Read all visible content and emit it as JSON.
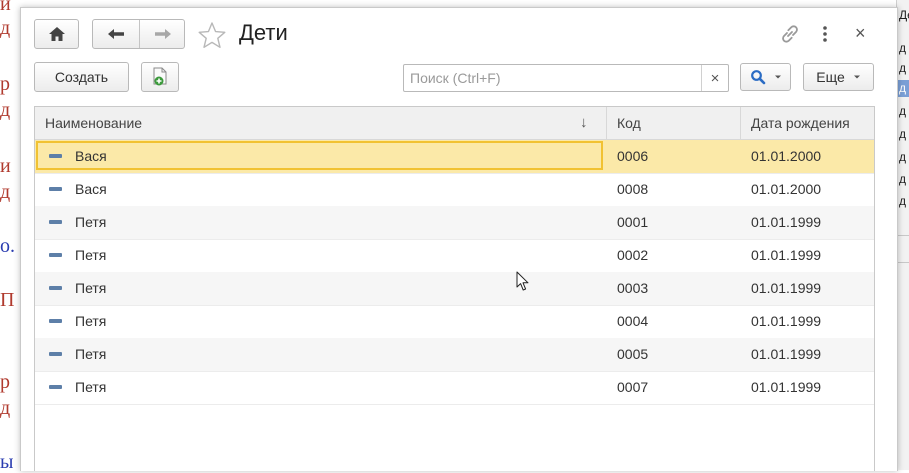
{
  "window": {
    "title": "Дети",
    "create_label": "Создать",
    "more_label": "Еще",
    "search_placeholder": "Поиск (Ctrl+F)",
    "search_value": "",
    "clear_glyph": "×",
    "close_glyph": "×"
  },
  "icons": {
    "home": "home-icon",
    "back": "arrow-left-icon",
    "forward": "arrow-right-icon",
    "favorite": "star-icon",
    "link": "link-icon",
    "menu": "more-vertical-icon",
    "close": "close-icon",
    "copy": "copy-add-icon",
    "search": "magnifier-icon",
    "row": "catalog-item-icon"
  },
  "colors": {
    "selected_row": "#fbe9a8",
    "selected_border": "#f1c232",
    "header_bg": "#f0f0f0",
    "item_icon": "#5d7fa8"
  },
  "table": {
    "columns": [
      {
        "label": "Наименование",
        "sort": "↓"
      },
      {
        "label": "Код"
      },
      {
        "label": "Дата рождения"
      }
    ],
    "rows": [
      {
        "name": "Вася",
        "code": "0006",
        "birth": "01.01.2000",
        "selected": true
      },
      {
        "name": "Вася",
        "code": "0008",
        "birth": "01.01.2000"
      },
      {
        "name": "Петя",
        "code": "0001",
        "birth": "01.01.1999"
      },
      {
        "name": "Петя",
        "code": "0002",
        "birth": "01.01.1999"
      },
      {
        "name": "Петя",
        "code": "0003",
        "birth": "01.01.1999"
      },
      {
        "name": "Петя",
        "code": "0004",
        "birth": "01.01.1999"
      },
      {
        "name": "Петя",
        "code": "0005",
        "birth": "01.01.1999"
      },
      {
        "name": "Петя",
        "code": "0007",
        "birth": "01.01.1999"
      }
    ]
  },
  "background": {
    "left_fragments": [
      "и",
      "д",
      "р",
      "д",
      "и",
      "д",
      "о.",
      "П",
      "р",
      "д",
      "ы"
    ],
    "right_fragments": [
      "Де",
      "д",
      "д",
      "д",
      "д",
      "д",
      "д",
      "д",
      "д"
    ]
  }
}
